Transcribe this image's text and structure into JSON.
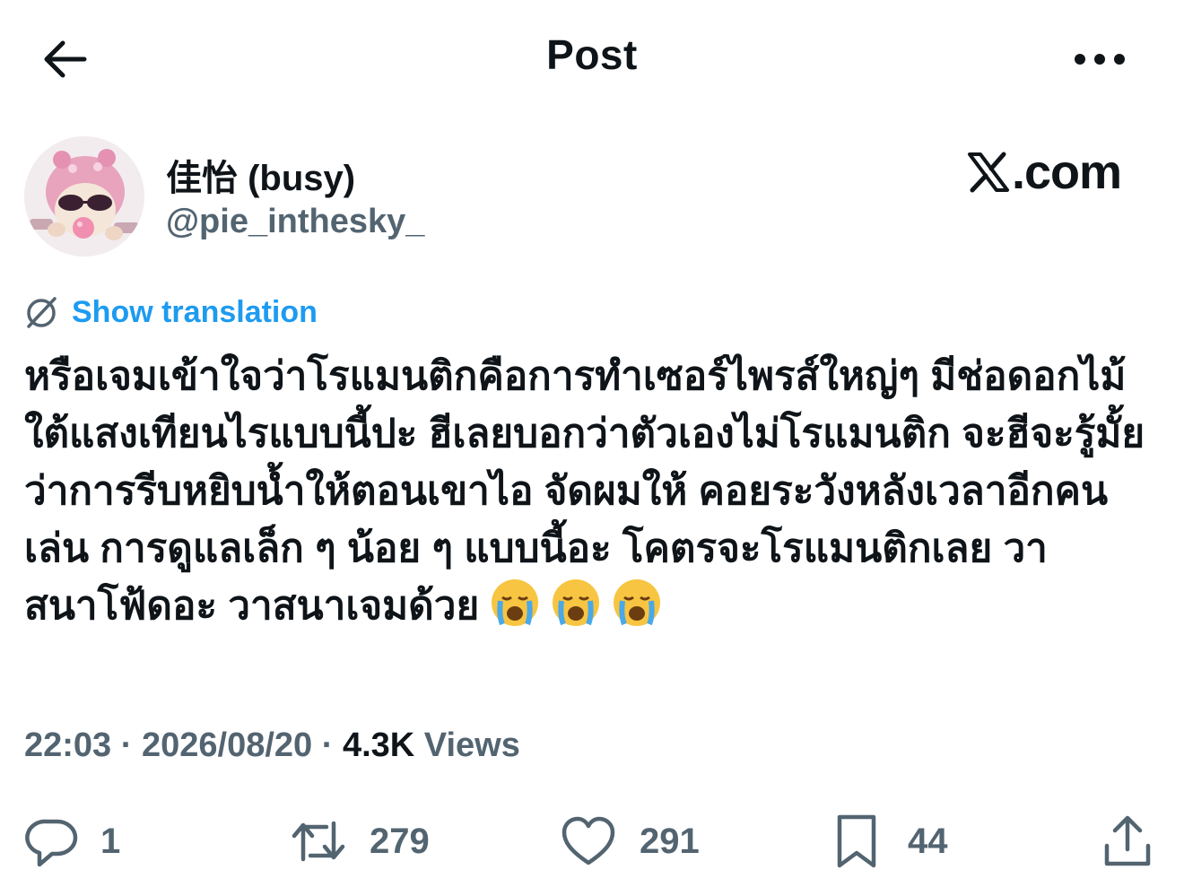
{
  "header": {
    "title": "Post",
    "back_icon": "arrow-left-icon",
    "more_icon": "more-horizontal-icon"
  },
  "author": {
    "display_name": "佳怡 (busy)",
    "handle": "@pie_inthesky_",
    "avatar": "avatar-pink-cat-sunglasses"
  },
  "brand": {
    "logo_text": "X",
    "suffix": ".com"
  },
  "translation": {
    "label": "Show translation",
    "icon": "translate-globe-icon"
  },
  "post": {
    "text": "หรือเจมเข้าใจว่าโรแมนติกคือการทำเซอร์ไพรส์ใหญ่ๆ มีช่อดอกไม้ใต้แสงเทียนไรแบบนี้ปะ ฮีเลยบอกว่าตัวเองไม่โรแมนติก จะฮีจะรู้มั้ยว่าการรีบหยิบน้ำให้ตอนเขาไอ จัดผมให้ คอยระวังหลังเวลาอีกคนเล่น การดูแลเล็ก ๆ น้อย ๆ แบบนี้อะ โคตรจะโรแมนติกเลย วาสนาโฟ้ดอะ วาสนาเจมด้วย",
    "emojis": [
      "😭",
      "😭",
      "😭"
    ]
  },
  "meta": {
    "time": "22:03",
    "sep1": "·",
    "date": "2026/08/20",
    "sep2": "·",
    "views_count": "4.3K",
    "views_label": "Views"
  },
  "actions": {
    "reply": {
      "icon": "reply-icon",
      "count": "1"
    },
    "repost": {
      "icon": "repost-icon",
      "count": "279"
    },
    "like": {
      "icon": "heart-icon",
      "count": "291"
    },
    "bookmark": {
      "icon": "bookmark-icon",
      "count": "44"
    },
    "share": {
      "icon": "share-icon"
    }
  },
  "colors": {
    "text_primary": "#0f1419",
    "text_secondary": "#536471",
    "accent": "#1d9bf0",
    "background": "#ffffff"
  }
}
